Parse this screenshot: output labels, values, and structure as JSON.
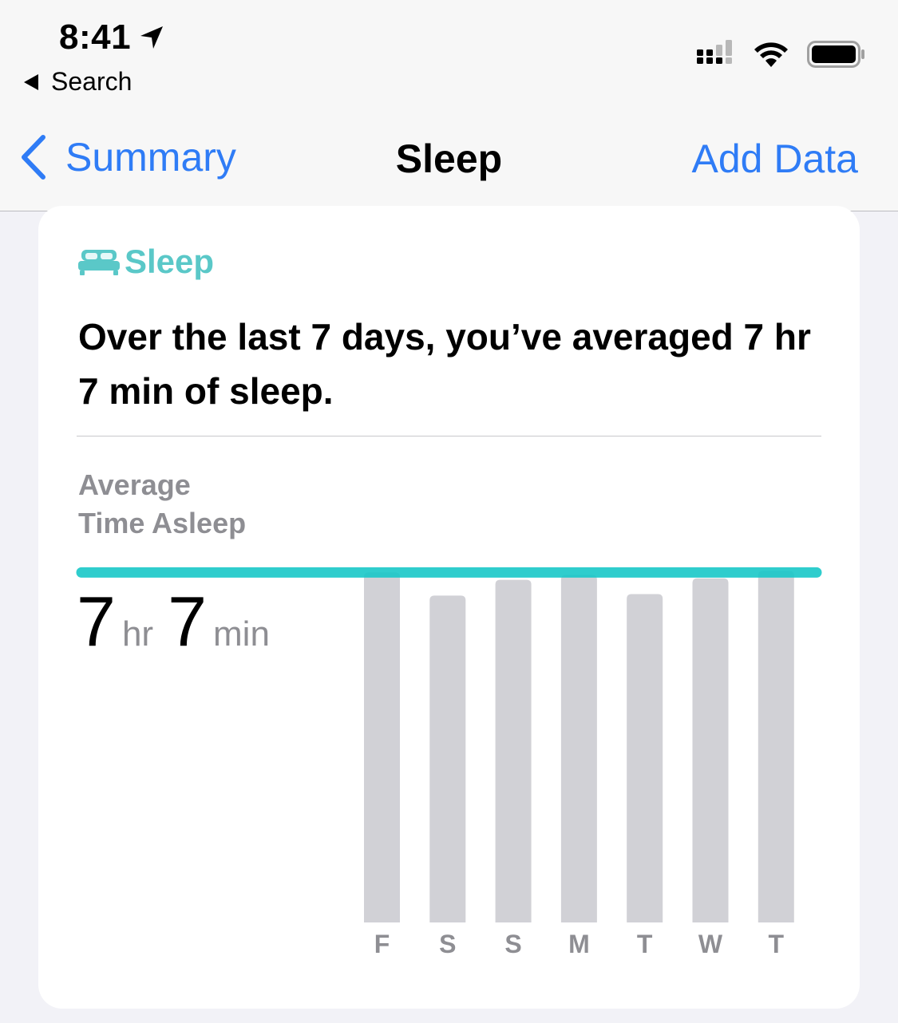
{
  "status_bar": {
    "time": "8:41",
    "back_app": "Search",
    "icons": [
      "location-arrow-icon",
      "cellular-signal-icon",
      "wifi-icon",
      "battery-icon"
    ]
  },
  "nav": {
    "back_label": "Summary",
    "title": "Sleep",
    "action_label": "Add Data"
  },
  "card": {
    "category": "Sleep",
    "category_icon": "bed-icon",
    "summary": "Over the last 7 days, you’ve averaged 7 hr 7 min of sleep.",
    "metric_label_line1": "Average",
    "metric_label_line2": "Time Asleep",
    "metric_hours": "7",
    "metric_hours_unit": "hr",
    "metric_minutes": "7",
    "metric_minutes_unit": "min"
  },
  "colors": {
    "accent": "#2f7cf6",
    "sleep_teal": "#5ac8c8",
    "average_line": "#19c8c8",
    "bar": "#d1d1d6",
    "muted_text": "#8e8e93"
  },
  "chart_data": {
    "type": "bar",
    "categories": [
      "F",
      "S",
      "S",
      "M",
      "T",
      "W",
      "T"
    ],
    "values": [
      7.12,
      6.65,
      6.97,
      7.07,
      6.68,
      7.0,
      7.15
    ],
    "average": 7.12,
    "ylim": [
      0,
      7.5
    ],
    "grid": false,
    "legend": "none"
  }
}
